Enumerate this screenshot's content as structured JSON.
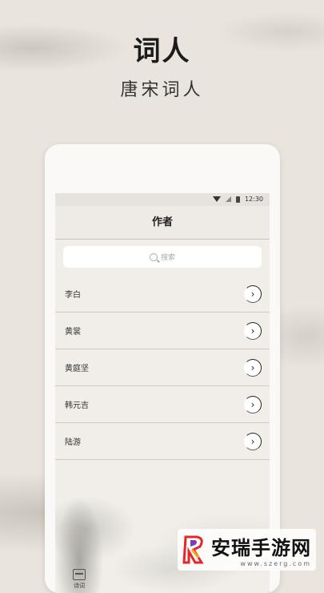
{
  "header": {
    "title": "词人",
    "subtitle": "唐宋词人"
  },
  "status_bar": {
    "time": "12:30"
  },
  "app_bar": {
    "title": "作者"
  },
  "search": {
    "placeholder": "搜索"
  },
  "poets": [
    {
      "name": "李白"
    },
    {
      "name": "黄裳"
    },
    {
      "name": "黄庭坚"
    },
    {
      "name": "韩元吉"
    },
    {
      "name": "陆游"
    }
  ],
  "bottom_nav": {
    "tab_label": "诗词"
  },
  "watermark": {
    "name": "安瑞手游网",
    "url": "www.szerg.com"
  },
  "colors": {
    "background": "#e9e5de",
    "screen": "#f1eee9",
    "accent_red": "#e0282d",
    "accent_purple": "#7a3fb8"
  }
}
